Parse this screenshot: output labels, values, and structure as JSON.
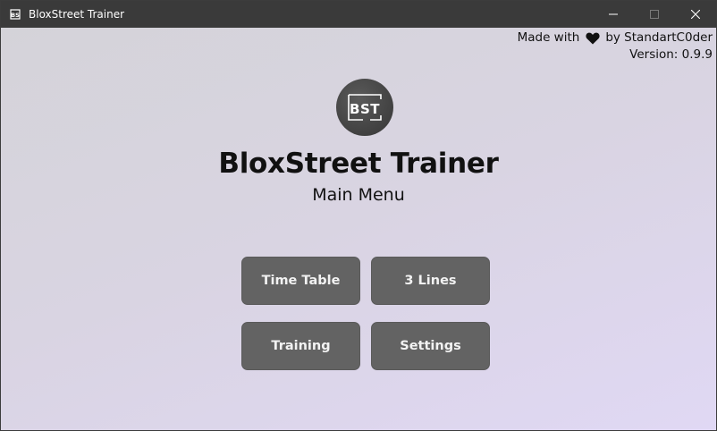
{
  "window": {
    "title": "BloxStreet Trainer",
    "controls": [
      "minimize",
      "maximize",
      "close"
    ]
  },
  "credits": {
    "made_with": "Made with",
    "heart_icon": "heart-icon",
    "by": "by StandartC0der",
    "version": "Version: 0.9.9"
  },
  "logo": {
    "text": "BST"
  },
  "header": {
    "title": "BloxStreet Trainer",
    "subtitle": "Main Menu"
  },
  "menu": {
    "time_table": "Time Table",
    "three_lines": "3 Lines",
    "training": "Training",
    "settings": "Settings"
  },
  "colors": {
    "titlebar": "#3a3a3a",
    "button": "#636363",
    "background_start": "#d4d3d8",
    "background_end": "#e0d8f4"
  }
}
